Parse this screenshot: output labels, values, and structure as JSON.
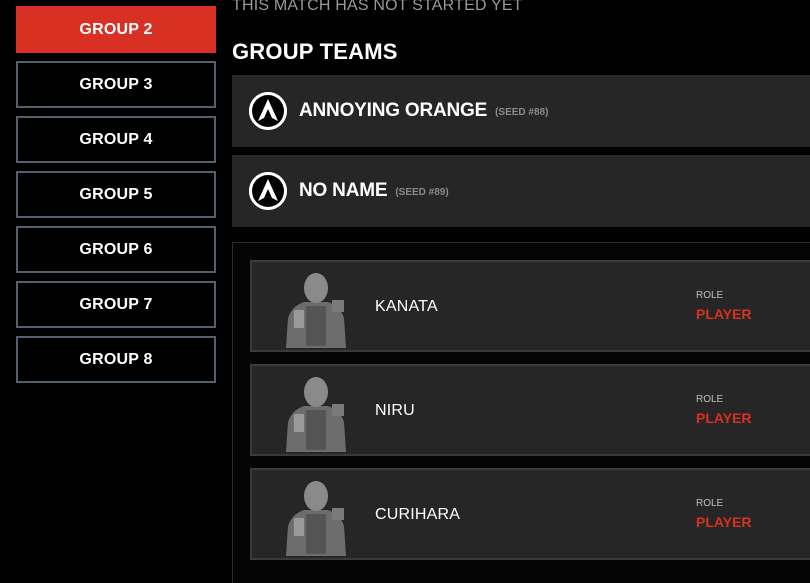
{
  "sidebar": {
    "groups": [
      {
        "label": "GROUP 2",
        "active": true
      },
      {
        "label": "GROUP 3"
      },
      {
        "label": "GROUP 4"
      },
      {
        "label": "GROUP 5"
      },
      {
        "label": "GROUP 6"
      },
      {
        "label": "GROUP 7"
      },
      {
        "label": "GROUP 8"
      }
    ]
  },
  "main": {
    "status": "THIS MATCH HAS NOT STARTED YET",
    "section_title": "GROUP TEAMS",
    "teams": [
      {
        "name": "ANNOYING ORANGE",
        "seed": "(SEED #88)",
        "logo": "apex-legends-logo-icon"
      },
      {
        "name": "NO NAME",
        "seed": "(SEED #89)",
        "logo": "apex-legends-logo-icon"
      }
    ],
    "players": [
      {
        "name": "KANATA",
        "role_label": "ROLE",
        "role": "PLAYER",
        "avatar": "legend-portrait-icon"
      },
      {
        "name": "NIRU",
        "role_label": "ROLE",
        "role": "PLAYER",
        "avatar": "legend-portrait-icon"
      },
      {
        "name": "CURIHARA",
        "role_label": "ROLE",
        "role": "PLAYER",
        "avatar": "legend-portrait-icon"
      }
    ]
  },
  "colors": {
    "accent": "#d83023",
    "card": "#262626",
    "border": "#55606e"
  }
}
